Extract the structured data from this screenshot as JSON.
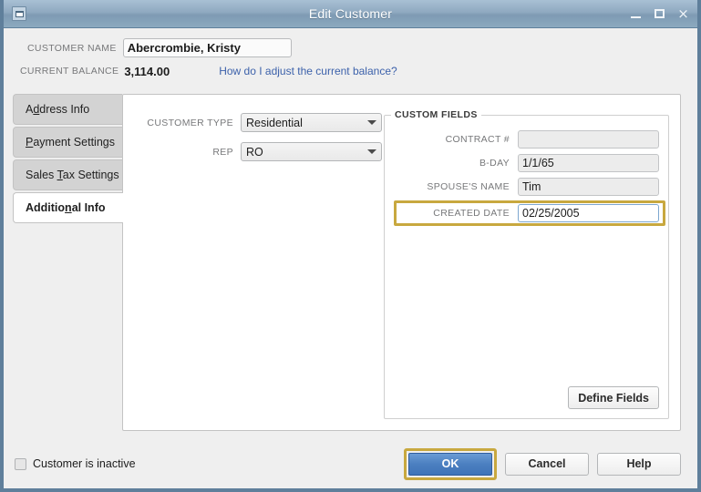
{
  "window": {
    "title": "Edit Customer",
    "system_icon": "window-restore-icon",
    "minimize_icon": "minimize-icon",
    "maximize_icon": "maximize-icon",
    "close_icon": "close-icon",
    "close_glyph": "×"
  },
  "header": {
    "customer_name_label": "CUSTOMER NAME",
    "customer_name_value": "Abercrombie, Kristy",
    "customer_name_placeholder": "",
    "current_balance_label": "CURRENT BALANCE",
    "current_balance_value": "3,114.00",
    "adjust_balance_link": "How do I adjust the current balance?"
  },
  "tabs": [
    {
      "label": "Address Info",
      "mnemonic_before": "A",
      "mnemonic": "d",
      "mnemonic_after": "dress Info",
      "active": false
    },
    {
      "label": "Payment Settings",
      "mnemonic_before": "",
      "mnemonic": "P",
      "mnemonic_after": "ayment Settings",
      "active": false
    },
    {
      "label": "Sales Tax Settings",
      "mnemonic_before": "Sales ",
      "mnemonic": "T",
      "mnemonic_after": "ax Settings",
      "active": false
    },
    {
      "label": "Additional Info",
      "mnemonic_before": "Additio",
      "mnemonic": "n",
      "mnemonic_after": "al Info",
      "active": true
    }
  ],
  "form": {
    "customer_type_label": "CUSTOMER TYPE",
    "customer_type_value": "Residential",
    "rep_label": "REP",
    "rep_value": "RO"
  },
  "custom_fields": {
    "group_title": "CUSTOM FIELDS",
    "rows": [
      {
        "label": "CONTRACT #",
        "value": "",
        "focused": false
      },
      {
        "label": "B-DAY",
        "value": "1/1/65",
        "focused": false
      },
      {
        "label": "SPOUSE'S NAME",
        "value": "Tim",
        "focused": false
      },
      {
        "label": "CREATED DATE",
        "value": "02/25/2005",
        "focused": true
      }
    ],
    "define_fields_label": "Define Fields"
  },
  "footer": {
    "inactive_checkbox_label": "Customer is inactive",
    "inactive_checked": false,
    "ok_label": "OK",
    "cancel_label": "Cancel",
    "help_label": "Help"
  },
  "colors": {
    "titlebar_top": "#a8c0d4",
    "titlebar_bottom": "#8caabf",
    "window_border": "#5f7f9b",
    "link_blue": "#3d62ab",
    "focus_gold": "#c8a83f",
    "ok_blue": "#4b7fc0",
    "panel_white": "#ffffff",
    "dialog_gray": "#efefef",
    "tab_gray": "#d3d3d3",
    "field_gray": "#ececec"
  }
}
